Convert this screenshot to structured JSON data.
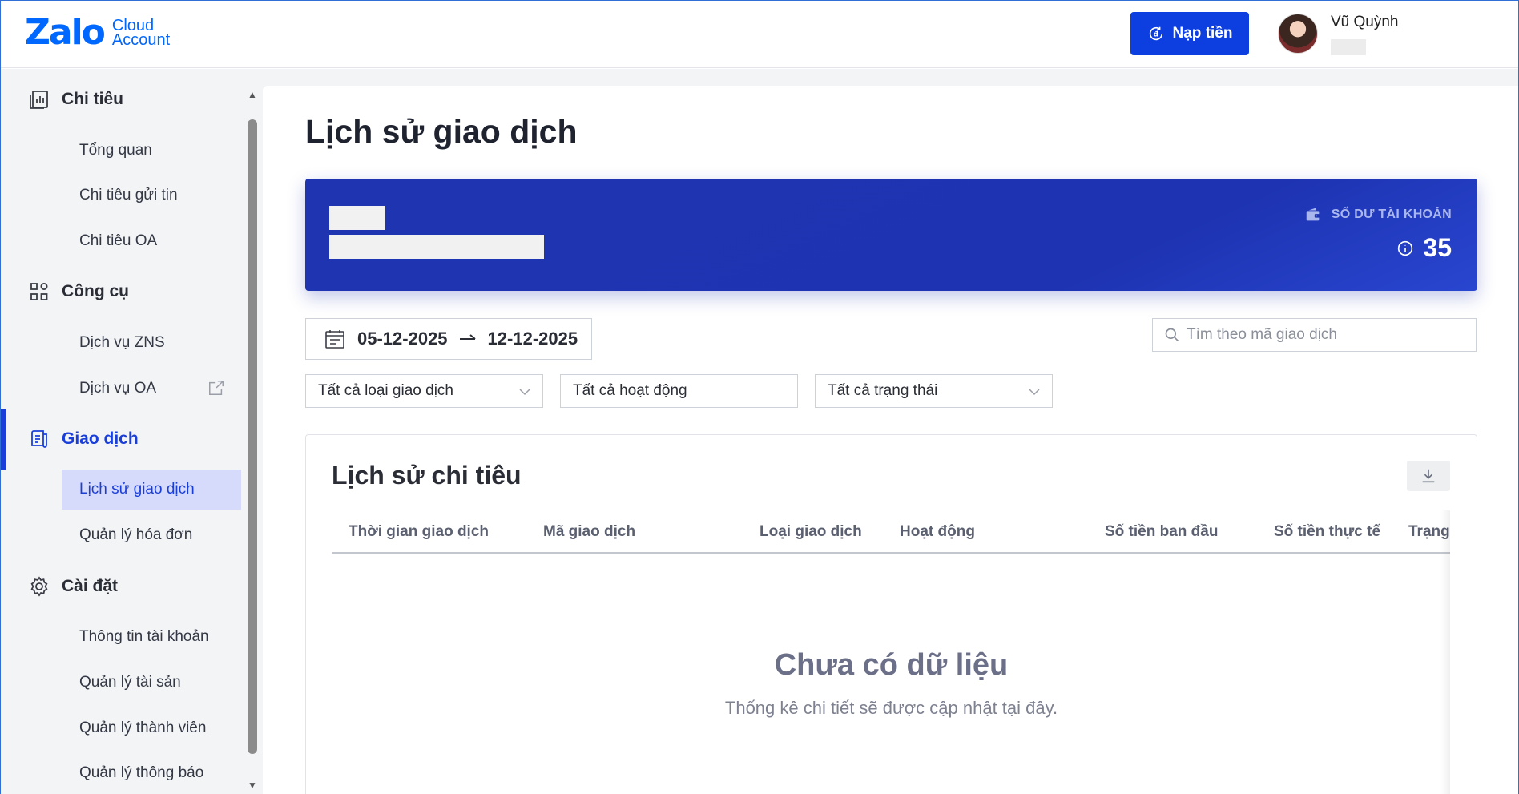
{
  "header": {
    "logo_main": "Zalo",
    "logo_sub_1": "Cloud",
    "logo_sub_2": "Account",
    "topup_label": "Nạp tiền",
    "user_name": "Vũ Quỳnh"
  },
  "sidebar": {
    "sections": [
      {
        "label": "Chi tiêu",
        "icon": "chart-report-icon"
      },
      {
        "label": "Công cụ",
        "icon": "grid-apps-icon"
      },
      {
        "label": "Giao dịch",
        "icon": "receipt-icon"
      },
      {
        "label": "Cài đặt",
        "icon": "gear-icon"
      }
    ],
    "items": {
      "tong_quan": "Tổng quan",
      "chi_tieu_gui_tin": "Chi tiêu gửi tin",
      "chi_tieu_oa": "Chi tiêu OA",
      "dich_vu_zns": "Dịch vụ ZNS",
      "dich_vu_oa": "Dịch vụ OA",
      "lich_su_giao_dich": "Lịch sử giao dịch",
      "quan_ly_hoa_don": "Quản lý hóa đơn",
      "thong_tin_tai_khoan": "Thông tin tài khoản",
      "quan_ly_tai_san": "Quản lý tài sản",
      "quan_ly_thanh_vien": "Quản lý thành viên",
      "quan_ly_thong_bao": "Quản lý thông báo"
    },
    "active_section": "Giao dịch",
    "selected_item": "Lịch sử giao dịch"
  },
  "main": {
    "page_title": "Lịch sử giao dịch",
    "balance": {
      "label": "SỐ DƯ TÀI KHOẢN",
      "value": "35"
    },
    "date_range": {
      "start": "05-12-2025",
      "end": "12-12-2025"
    },
    "search": {
      "placeholder": "Tìm theo mã giao dịch"
    },
    "filters": {
      "type": "Tất cả loại giao dịch",
      "activity": "Tất cả hoạt động",
      "status": "Tất cả trạng thái"
    },
    "table": {
      "title": "Lịch sử chi tiêu",
      "columns": [
        "Thời gian giao dịch",
        "Mã giao dịch",
        "Loại giao dịch",
        "Hoạt động",
        "Số tiền ban đầu",
        "Số tiền thực tế",
        "Trạng"
      ],
      "empty_title": "Chưa có dữ liệu",
      "empty_subtitle": "Thống kê chi tiết sẽ được cập nhật tại đây."
    }
  },
  "colors": {
    "brand": "#0068ff",
    "primary_button": "#0d3ee0",
    "active_nav": "#1a3fd9",
    "selected_item_bg": "#d6dafb",
    "balance_card": "#1e34b0"
  }
}
